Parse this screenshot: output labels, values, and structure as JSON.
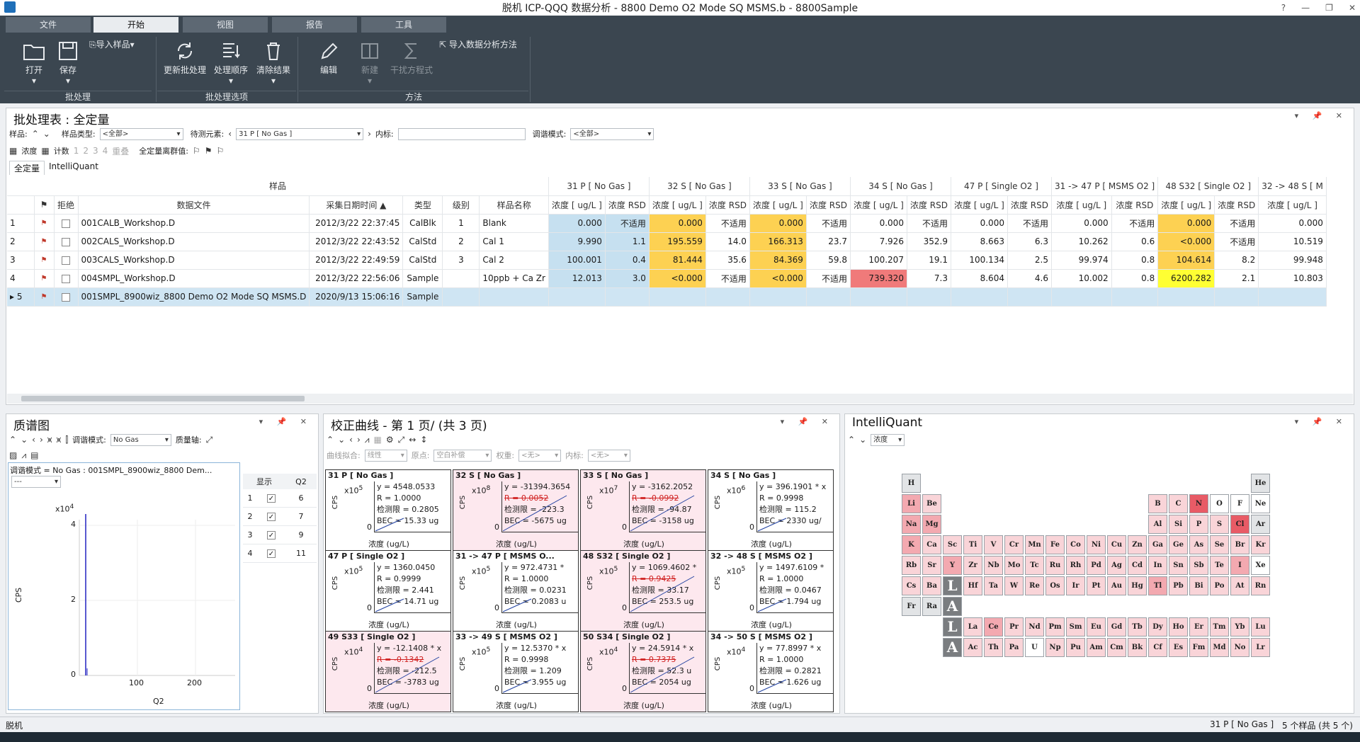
{
  "window": {
    "title": "脱机 ICP-QQQ 数据分析 - 8800 Demo O2 Mode SQ MSMS.b - 8800Sample",
    "buttons": [
      "?",
      "—",
      "❐",
      "✕"
    ]
  },
  "ribbon": {
    "tabs": [
      "文件",
      "开始",
      "视图",
      "报告",
      "工具"
    ],
    "import_sample": "导入样品",
    "open": "打开",
    "save": "保存",
    "refresh": "更新批处理",
    "order": "处理顺序",
    "clear": "清除结果",
    "edit": "编辑",
    "new": "新建",
    "interf": "干扰方程式",
    "import_method": "导入数据分析方法",
    "groups": [
      "批处理",
      "批处理选项",
      "方法"
    ]
  },
  "batch": {
    "title": "批处理表 : 全定量",
    "ctrl": "▾ 📌 ✕",
    "samples_label": "样品:",
    "sample_type_label": "样品类型:",
    "sample_type_val": "<全部>",
    "element_label": "待测元素:",
    "element_val": "31 P [ No Gas ]",
    "istd_label": "内标:",
    "tune_label": "调谐模式:",
    "tune_val": "<全部>",
    "conc_label": "浓度",
    "count_label": "计数",
    "b1": "1",
    "b2": "2",
    "b3": "3",
    "b4": "4",
    "reset": "重叠",
    "outlier_label": "全定量离群值:",
    "tabs": [
      "全定量",
      "IntelliQuant"
    ],
    "group_sample": "样品",
    "groups": [
      "31  P  [ No Gas ]",
      "32  S  [ No Gas ]",
      "33  S  [ No Gas ]",
      "34  S  [ No Gas ]",
      "47  P  [ Single O2 ]",
      "31 -> 47  P  [ MSMS O2 ]",
      "48  S32  [ Single O2 ]",
      "32 -> 48  S  [ M"
    ],
    "cols": {
      "reject": "拒绝",
      "file": "数据文件",
      "date": "采集日期时间",
      "type": "类型",
      "level": "级别",
      "name": "样品名称",
      "conc": "浓度 [ ug/L ]",
      "rsd": "浓度 RSD"
    },
    "rows": [
      {
        "n": "1",
        "file": "001CALB_Workshop.D",
        "date": "2012/3/22 22:37:45",
        "type": "CalBlk",
        "level": "1",
        "name": "Blank",
        "v": [
          "0.000",
          "不适用",
          "0.000",
          "不适用",
          "0.000",
          "不适用",
          "0.000",
          "不适用",
          "0.000",
          "不适用",
          "0.000",
          "不适用",
          "0.000",
          "不适用",
          "0.000"
        ]
      },
      {
        "n": "2",
        "file": "002CALS_Workshop.D",
        "date": "2012/3/22 22:43:52",
        "type": "CalStd",
        "level": "2",
        "name": "Cal 1",
        "v": [
          "9.990",
          "1.1",
          "195.559",
          "14.0",
          "166.313",
          "23.7",
          "7.926",
          "352.9",
          "8.663",
          "6.3",
          "10.262",
          "0.6",
          "<0.000",
          "不适用",
          "10.519"
        ]
      },
      {
        "n": "3",
        "file": "003CALS_Workshop.D",
        "date": "2012/3/22 22:49:59",
        "type": "CalStd",
        "level": "3",
        "name": "Cal 2",
        "v": [
          "100.001",
          "0.4",
          "81.444",
          "35.6",
          "84.369",
          "59.8",
          "100.207",
          "19.1",
          "100.134",
          "2.5",
          "99.974",
          "0.8",
          "104.614",
          "8.2",
          "99.948"
        ]
      },
      {
        "n": "4",
        "file": "004SMPL_Workshop.D",
        "date": "2012/3/22 22:56:06",
        "type": "Sample",
        "level": "",
        "name": "10ppb + Ca Zr",
        "v": [
          "12.013",
          "3.0",
          "<0.000",
          "不适用",
          "<0.000",
          "不适用",
          "739.320",
          "7.3",
          "8.604",
          "4.6",
          "10.002",
          "0.8",
          "6200.282",
          "2.1",
          "10.803"
        ]
      },
      {
        "n": "5",
        "file": "001SMPL_8900wiz_8800 Demo O2 Mode SQ MSMS.D",
        "date": "2020/9/13 15:06:16",
        "type": "Sample",
        "level": "",
        "name": "",
        "v": [
          "",
          "",
          "",
          "",
          "",
          "",
          "",
          "",
          "",
          "",
          "",
          "",
          "",
          "",
          ""
        ]
      }
    ]
  },
  "spectrum": {
    "title": "质谱图",
    "tune_label": "调谐模式:",
    "tune_val": "No Gas",
    "mass_label": "质量轴:",
    "info": "调谐模式 =    No Gas : 001SMPL_8900wiz_8800 Dem...",
    "dash": "---",
    "ylabel": "CPS",
    "xlabel": "Q2",
    "x10": "x10",
    "exp": "4",
    "yticks": [
      "4",
      "2",
      "0"
    ],
    "xticks": [
      "100",
      "200"
    ],
    "table": {
      "h_show": "显示",
      "h_q2": "Q2",
      "rows": [
        [
          "1",
          "6"
        ],
        [
          "2",
          "7"
        ],
        [
          "3",
          "9"
        ],
        [
          "4",
          "11"
        ]
      ]
    }
  },
  "calib": {
    "title": "校正曲线 - 第 1 页/ (共 3 页)",
    "fit_label": "曲线拟合:",
    "fit_val": "线性",
    "origin_label": "原点:",
    "origin_val": "空白补偿",
    "w_label": "权重:",
    "w_val": "<无>",
    "istd_label": "内标:",
    "istd_val": "<无>",
    "cells": [
      {
        "h": "31  P  [ No Gas ]",
        "e": "5",
        "l1": "y = 4548.0533",
        "l2": "R = 1.0000",
        "l3": "检测限 = 0.2805",
        "l4": "BEC = 15.33 ug",
        "red": false
      },
      {
        "h": "32  S  [ No Gas ]",
        "e": "8",
        "l1": "y = -31394.3654",
        "l2": "R = 0.0052",
        "l3": "检测限 = -223.3",
        "l4": "BEC = -5675 ug",
        "red": true
      },
      {
        "h": "33  S  [ No Gas ]",
        "e": "7",
        "l1": "y = -3162.2052",
        "l2": "R = -0.0992",
        "l3": "检测限 = -94.87",
        "l4": "BEC = -3158 ug",
        "red": true
      },
      {
        "h": "34  S  [ No Gas ]",
        "e": "6",
        "l1": "y = 396.1901 * x",
        "l2": "R = 0.9998",
        "l3": "检测限 = 115.2",
        "l4": "BEC = 2330 ug/",
        "red": false
      },
      {
        "h": "47  P  [ Single O2 ]",
        "e": "5",
        "l1": "y = 1360.0450",
        "l2": "R = 0.9999",
        "l3": "检测限 = 2.441",
        "l4": "BEC = 14.71 ug",
        "red": false
      },
      {
        "h": "31 -> 47  P  [ MSMS O...",
        "e": "5",
        "l1": "y = 972.4731 *",
        "l2": "R = 1.0000",
        "l3": "检测限 = 0.0231",
        "l4": "BEC = 0.2083 u",
        "red": false
      },
      {
        "h": "48  S32  [ Single O2 ]",
        "e": "5",
        "l1": "y = 1069.4602 *",
        "l2": "R = 0.9425",
        "l3": "检测限 = 33.17",
        "l4": "BEC = 253.5 ug",
        "red": true
      },
      {
        "h": "32 -> 48  S  [ MSMS O2 ]",
        "e": "5",
        "l1": "y = 1497.6109 *",
        "l2": "R = 1.0000",
        "l3": "检测限 = 0.0467",
        "l4": "BEC = 1.794 ug",
        "red": false
      },
      {
        "h": "49  S33  [ Single O2 ]",
        "e": "4",
        "l1": "y = -12.1408 * x",
        "l2": "R = -0.1342",
        "l3": "检测限 = -212.5",
        "l4": "BEC = -3783 ug",
        "red": true
      },
      {
        "h": "33 -> 49  S  [ MSMS O2 ]",
        "e": "5",
        "l1": "y = 12.5370 * x",
        "l2": "R = 0.9998",
        "l3": "检测限 = 1.209",
        "l4": "BEC = 3.955 ug",
        "red": false
      },
      {
        "h": "50  S34  [ Single O2 ]",
        "e": "4",
        "l1": "y = 24.5914 * x",
        "l2": "R = 0.7375",
        "l3": "检测限 = 52.3 u",
        "l4": "BEC = 2054 ug",
        "red": true
      },
      {
        "h": "34 -> 50  S  [ MSMS O2 ]",
        "e": "4",
        "l1": "y = 77.8997 * x",
        "l2": "R = 1.0000",
        "l3": "检测限 = 0.2821",
        "l4": "BEC = 1.626 ug",
        "red": false
      }
    ],
    "ylabel": "CPS",
    "x10": "x10",
    "zero": "0",
    "xlabel": "浓度 (ug/L)"
  },
  "iq": {
    "title": "IntelliQuant",
    "mode_val": "浓度"
  },
  "status": {
    "left": "脱机",
    "mid": "31  P  [ No Gas ]",
    "right": "5 个样品 (共 5 个)"
  }
}
